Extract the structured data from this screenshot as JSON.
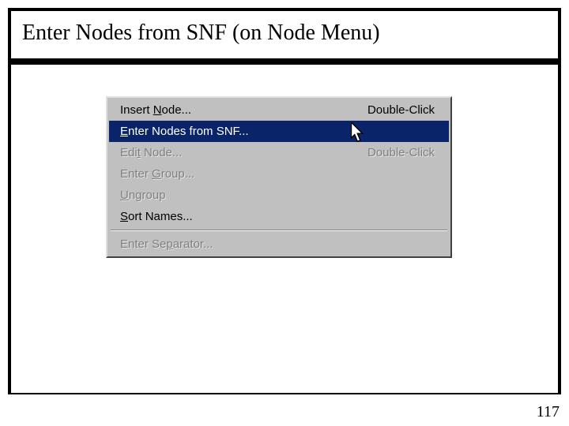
{
  "title": "Enter Nodes from SNF (on Node Menu)",
  "page_number": "117",
  "menu": {
    "items": [
      {
        "label_pre": "Insert ",
        "mnemonic": "N",
        "label_post": "ode...",
        "shortcut": "Double-Click",
        "state": "normal"
      },
      {
        "label_pre": "",
        "mnemonic": "E",
        "label_post": "nter Nodes from SNF...",
        "shortcut": "",
        "state": "highlight"
      },
      {
        "label_pre": "Edi",
        "mnemonic": "t",
        "label_post": " Node...",
        "shortcut": "Double-Click",
        "state": "disabled"
      },
      {
        "label_pre": "Enter ",
        "mnemonic": "G",
        "label_post": "roup...",
        "shortcut": "",
        "state": "disabled"
      },
      {
        "label_pre": "",
        "mnemonic": "U",
        "label_post": "ngroup",
        "shortcut": "",
        "state": "disabled"
      },
      {
        "label_pre": "",
        "mnemonic": "S",
        "label_post": "ort Names...",
        "shortcut": "",
        "state": "normal"
      }
    ],
    "separator_item": {
      "label_pre": "Enter Se",
      "mnemonic": "p",
      "label_post": "arator...",
      "shortcut": "",
      "state": "disabled"
    }
  }
}
